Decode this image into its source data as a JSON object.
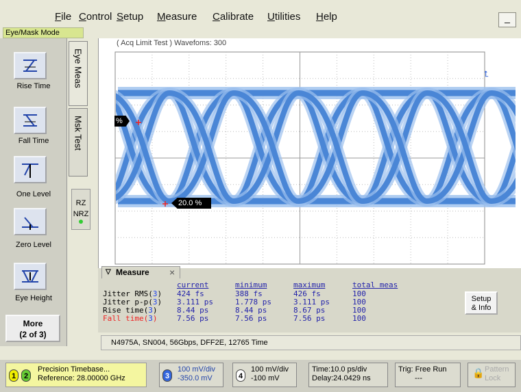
{
  "menu": {
    "items": [
      "File",
      "Control",
      "Setup",
      "Measure",
      "Calibrate",
      "Utilities",
      "Help"
    ],
    "minimize": "_"
  },
  "mode_label": "Eye/Mask Mode",
  "tools": [
    {
      "label": "Rise Time"
    },
    {
      "label": "Fall Time"
    },
    {
      "label": "One Level"
    },
    {
      "label": "Zero Level"
    },
    {
      "label": "Eye Height"
    }
  ],
  "more_button": {
    "line1": "More",
    "line2": "(2 of 3)"
  },
  "tabs": {
    "eye_meas": "Eye Meas",
    "mask_test": "Msk Test"
  },
  "rz": "RZ",
  "nrz": "NRZ",
  "scope": {
    "acq_label": "( Acq Limit Test )  Wavefoms: 300",
    "marker_left": "%",
    "marker_mid": "20.0 %",
    "colors": {
      "trace": "#4a86d6",
      "trace_light": "#9cc0ee",
      "marker": "#ee2222"
    }
  },
  "measure": {
    "title": "Measure",
    "close": "×",
    "headers": [
      "current",
      "minimum",
      "maximum",
      "total meas"
    ],
    "rows": [
      {
        "label": "Jitter RMS(",
        "ch": "3",
        "close": ")",
        "values": [
          "424 fs",
          "388 fs",
          "426 fs",
          "100"
        ],
        "color": "#000000"
      },
      {
        "label": "Jitter p-p(",
        "ch": "3",
        "close": ")",
        "values": [
          "3.111 ps",
          "1.778 ps",
          "3.111 ps",
          "100"
        ],
        "color": "#000000"
      },
      {
        "label": "Rise time(",
        "ch": "3",
        "close": ")",
        "values": [
          "8.44 ps",
          "8.44 ps",
          "8.67 ps",
          "100"
        ],
        "color": "#000000"
      },
      {
        "label": "Fall time(",
        "ch": "3",
        "close": ")",
        "values": [
          "7.56 ps",
          "7.56 ps",
          "7.56 ps",
          "100"
        ],
        "color": "#ee2222"
      }
    ],
    "setup_line1": "Setup",
    "setup_line2": "& Info"
  },
  "info_bar": "N4975A, SN004, 56Gbps, DFF2E, 12765 Time",
  "status": {
    "ch1": "1",
    "ch2": "2",
    "timebase_line1": "Precision Timebase...",
    "timebase_line2": "Reference: 28.00000 GHz",
    "ch3": "3",
    "ch3_line1": "100 mV/div",
    "ch3_line2": "-350.0 mV",
    "ch4": "4",
    "ch4_line1": "100 mV/div",
    "ch4_line2": "-100 mV",
    "time_line1": "Time:10.0 ps/div",
    "time_line2": "Delay:24.0429 ns",
    "trig_line1": "Trig: Free Run",
    "trig_line2": "---",
    "pattern_line1": "Pattern",
    "pattern_line2": "Lock"
  }
}
